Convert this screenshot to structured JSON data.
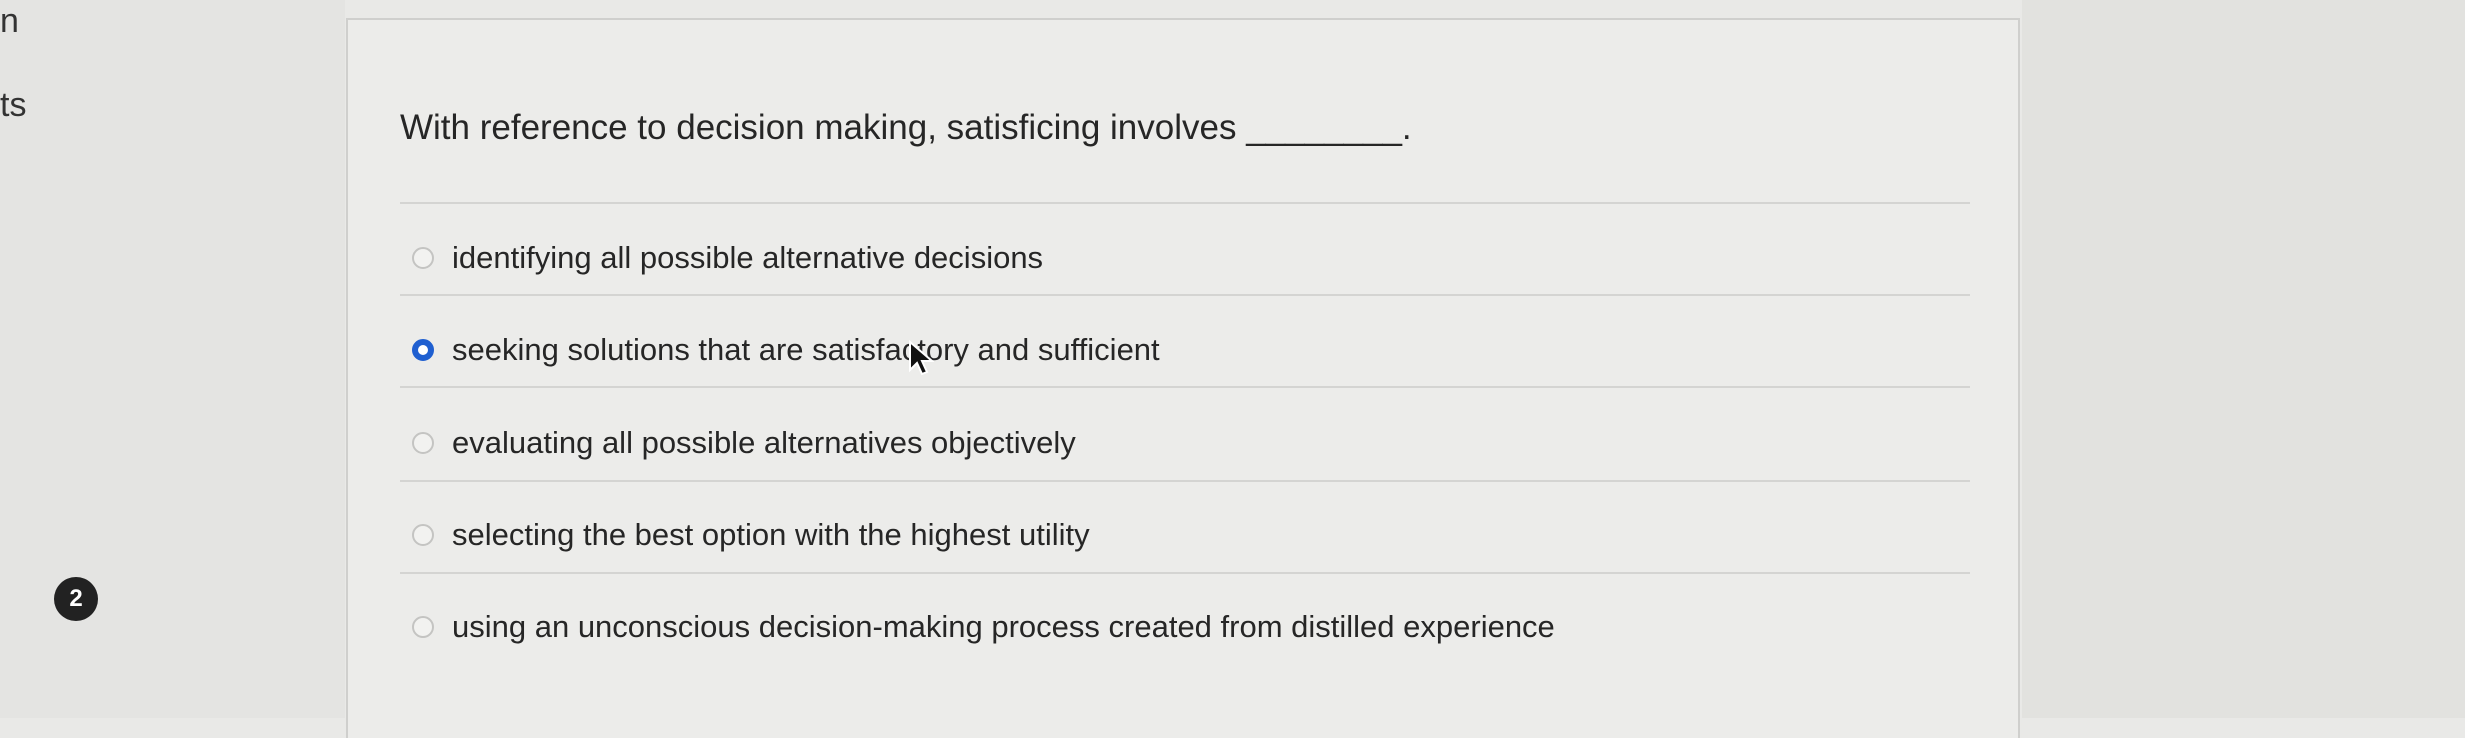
{
  "left_rail": {
    "fragment_top": "n",
    "fragment_mid": "ts",
    "question_number": "2"
  },
  "question": {
    "text": "With reference to decision making, satisficing involves ________."
  },
  "options": [
    {
      "label": "identifying all possible alternative decisions",
      "selected": false
    },
    {
      "label": "seeking solutions that are satisfactory and sufficient",
      "selected": true
    },
    {
      "label": "evaluating all possible alternatives objectively",
      "selected": false
    },
    {
      "label": "selecting the best option with the highest utility",
      "selected": false
    },
    {
      "label": "using an unconscious decision-making process created from distilled experience",
      "selected": false
    }
  ],
  "colors": {
    "selected_radio": "#1f5fd0",
    "background": "#e9e9e7"
  },
  "icons": {
    "cursor": "arrow-cursor-icon"
  }
}
